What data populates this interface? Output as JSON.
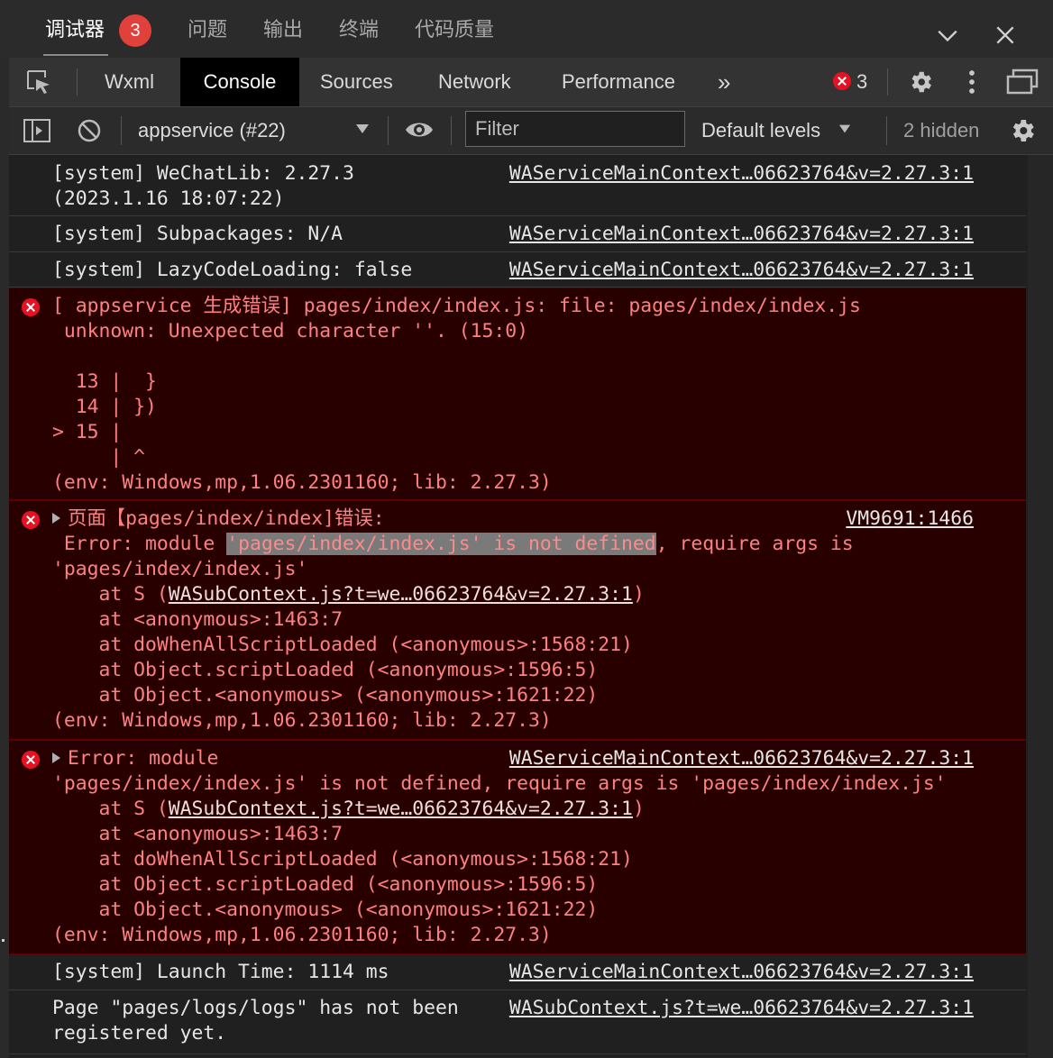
{
  "panel_tabs": {
    "debugger": "调试器",
    "debugger_badge": "3",
    "problems": "问题",
    "output": "输出",
    "terminal": "终端",
    "code_quality": "代码质量"
  },
  "devtools_tabs": {
    "wxml": "Wxml",
    "console": "Console",
    "sources": "Sources",
    "network": "Network",
    "performance": "Performance",
    "more": "»",
    "error_count": "3"
  },
  "console_toolbar": {
    "context": "appservice (#22)",
    "filter_placeholder": "Filter",
    "levels": "Default levels",
    "hidden": "2 hidden"
  },
  "logs": {
    "e1": {
      "line1": "[system] WeChatLib: 2.27.3",
      "line2": "(2023.1.16 18:07:22)",
      "source": "WAServiceMainContext…06623764&v=2.27.3:1"
    },
    "e2": {
      "line1": "[system] Subpackages: N/A",
      "source": "WAServiceMainContext…06623764&v=2.27.3:1"
    },
    "e3": {
      "line1": "[system] LazyCodeLoading: false",
      "source": "WAServiceMainContext…06623764&v=2.27.3:1"
    },
    "e4": {
      "line1": "[ appservice 生成错误] pages/index/index.js: file: pages/index/index.js",
      "line2": " unknown: Unexpected character ''. (15:0)",
      "line3": "",
      "line4": "  13 |  }",
      "line5": "  14 | })",
      "line6": "> 15 |",
      "line7": "     | ^",
      "line8": "(env: Windows,mp,1.06.2301160; lib: 2.27.3)"
    },
    "e5": {
      "head": "页面【pages/index/index]错误:",
      "source": "VM9691:1466",
      "line2a": " Error: module ",
      "line2b": "'pages/index/index.js' is not defined",
      "line2c": ", require args is",
      "line3": "'pages/index/index.js'",
      "line4a": "    at S (",
      "line4b": "WASubContext.js?t=we…06623764&v=2.27.3:1",
      "line4c": ")",
      "line5": "    at <anonymous>:1463:7",
      "line6": "    at doWhenAllScriptLoaded (<anonymous>:1568:21)",
      "line7": "    at Object.scriptLoaded (<anonymous>:1596:5)",
      "line8": "    at Object.<anonymous> (<anonymous>:1621:22)",
      "line9": "(env: Windows,mp,1.06.2301160; lib: 2.27.3)"
    },
    "e6": {
      "head": "Error: module",
      "source": "WAServiceMainContext…06623764&v=2.27.3:1",
      "line2": "'pages/index/index.js' is not defined, require args is 'pages/index/index.js'",
      "line3a": "    at S (",
      "line3b": "WASubContext.js?t=we…06623764&v=2.27.3:1",
      "line3c": ")",
      "line4": "    at <anonymous>:1463:7",
      "line5": "    at doWhenAllScriptLoaded (<anonymous>:1568:21)",
      "line6": "    at Object.scriptLoaded (<anonymous>:1596:5)",
      "line7": "    at Object.<anonymous> (<anonymous>:1621:22)",
      "line8": "(env: Windows,mp,1.06.2301160; lib: 2.27.3)"
    },
    "e7": {
      "line1": "[system] Launch Time: 1114 ms",
      "source": "WAServiceMainContext…06623764&v=2.27.3:1"
    },
    "e8": {
      "line1": "Page \"pages/logs/logs\" has not been",
      "line2": "registered yet.",
      "source": "WASubContext.js?t=we…06623764&v=2.27.3:1"
    }
  },
  "colors": {
    "error_bg": "#290000",
    "error_text": "#ff8080",
    "badge": "#e0413a"
  }
}
